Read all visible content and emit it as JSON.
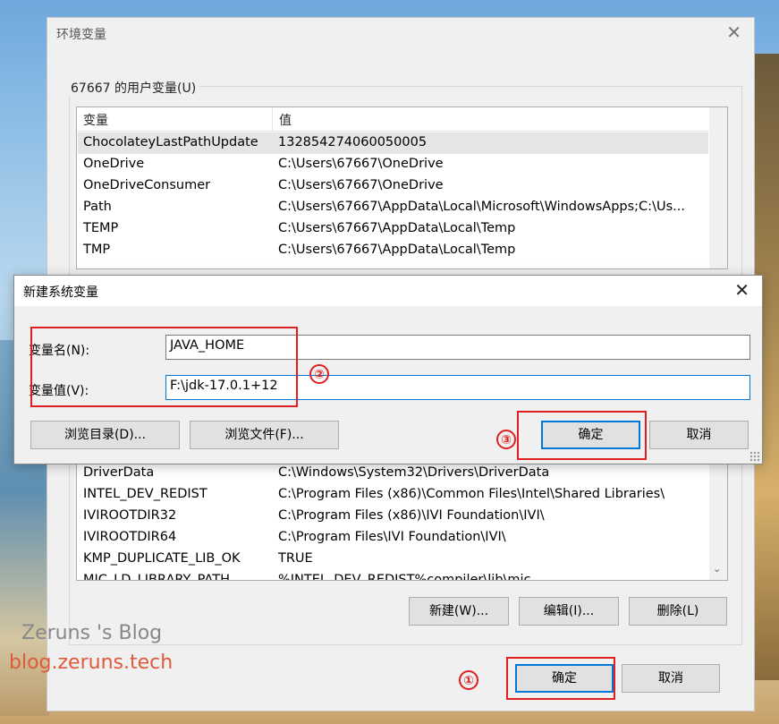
{
  "main_window": {
    "title": "环境变量",
    "user_group_label": "67667 的用户变量(U)",
    "columns": [
      "变量",
      "值"
    ],
    "user_vars": [
      {
        "name": "ChocolateyLastPathUpdate",
        "value": "132854274060050005"
      },
      {
        "name": "OneDrive",
        "value": "C:\\Users\\67667\\OneDrive"
      },
      {
        "name": "OneDriveConsumer",
        "value": "C:\\Users\\67667\\OneDrive"
      },
      {
        "name": "Path",
        "value": "C:\\Users\\67667\\AppData\\Local\\Microsoft\\WindowsApps;C:\\Us..."
      },
      {
        "name": "TEMP",
        "value": "C:\\Users\\67667\\AppData\\Local\\Temp"
      },
      {
        "name": "TMP",
        "value": "C:\\Users\\67667\\AppData\\Local\\Temp"
      }
    ],
    "system_vars": [
      {
        "name": "DriverData",
        "value": "C:\\Windows\\System32\\Drivers\\DriverData"
      },
      {
        "name": "INTEL_DEV_REDIST",
        "value": "C:\\Program Files (x86)\\Common Files\\Intel\\Shared Libraries\\"
      },
      {
        "name": "IVIROOTDIR32",
        "value": "C:\\Program Files (x86)\\IVI Foundation\\IVI\\"
      },
      {
        "name": "IVIROOTDIR64",
        "value": "C:\\Program Files\\IVI Foundation\\IVI\\"
      },
      {
        "name": "KMP_DUPLICATE_LIB_OK",
        "value": "TRUE"
      },
      {
        "name": "MIC_LD_LIBRARY_PATH",
        "value": "%INTEL_DEV_REDIST%compiler\\lib\\mic"
      }
    ],
    "sys_buttons": {
      "new": "新建(W)...",
      "edit": "编辑(I)...",
      "delete": "删除(L)"
    },
    "ok": "确定",
    "cancel": "取消"
  },
  "dialog": {
    "title": "新建系统变量",
    "name_label": "变量名(N):",
    "name_value": "JAVA_HOME",
    "value_label": "变量值(V):",
    "value_value": "F:\\jdk-17.0.1+12",
    "browse_dir": "浏览目录(D)...",
    "browse_file": "浏览文件(F)...",
    "ok": "确定",
    "cancel": "取消"
  },
  "annotations": {
    "one": "①",
    "two": "②",
    "three": "③"
  },
  "watermark": {
    "line1": "Zeruns 's Blog",
    "line2": "blog.zeruns.tech"
  },
  "colors": {
    "accent": "#0078d7",
    "annotation_red": "#e02020",
    "selected_row": "#e5e5e5"
  }
}
